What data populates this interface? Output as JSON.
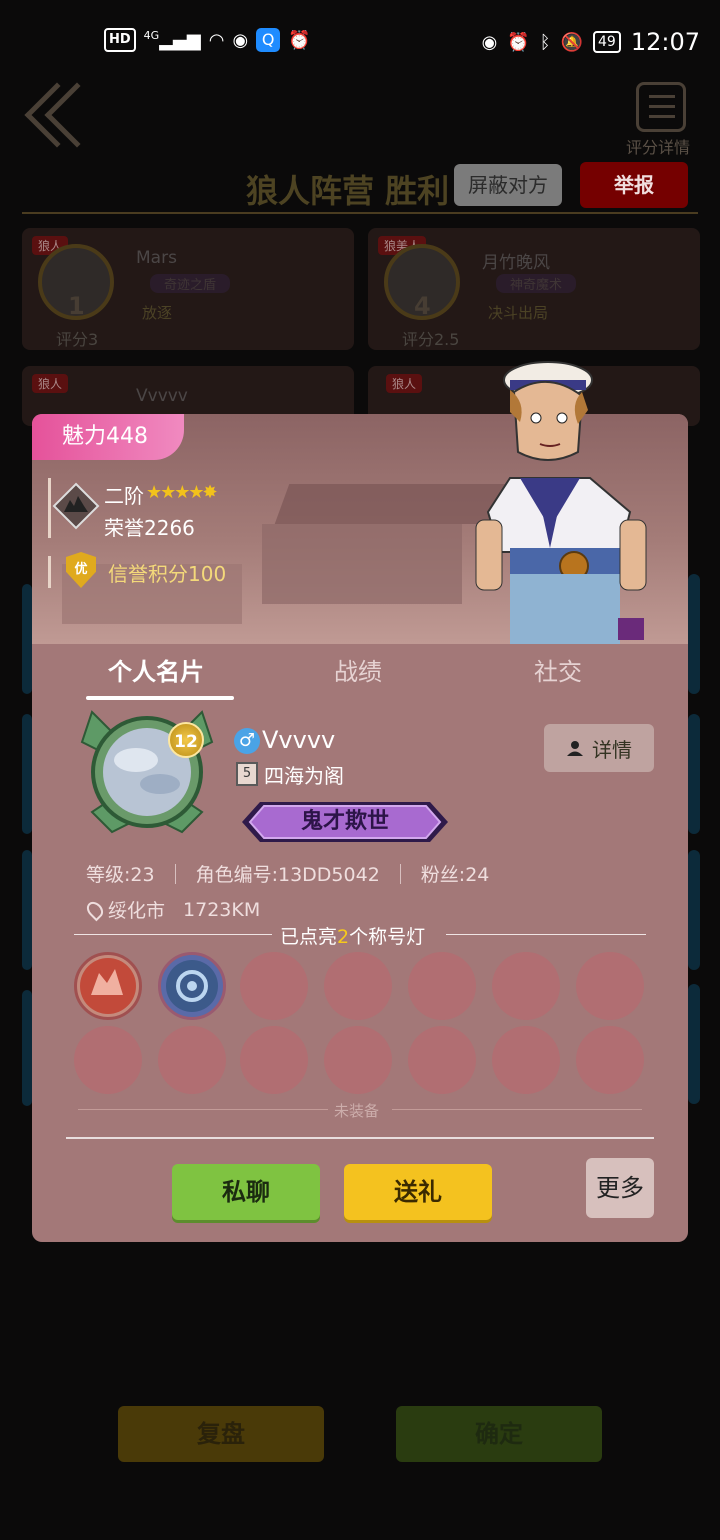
{
  "status_bar": {
    "hd": "HD",
    "network": "4G",
    "battery": "49",
    "time": "12:07"
  },
  "header": {
    "score_detail_label": "评分详情",
    "faction_result": "狼人阵营  胜利",
    "mute_button": "屏蔽对方",
    "report_button": "举报"
  },
  "players": [
    {
      "tag": "狼人",
      "seat": "1",
      "name": "Mars",
      "subtitle": "奇迹之盾",
      "badge": "放逐",
      "rating": "评分3"
    },
    {
      "tag": "狼美人",
      "seat": "4",
      "name": "月竹晚风",
      "subtitle": "神奇魔术",
      "badge": "决斗出局",
      "rating": "评分2.5"
    },
    {
      "tag": "狼人",
      "seat": "",
      "name": "Vvvvv",
      "subtitle": "",
      "badge": "",
      "rating": ""
    },
    {
      "tag": "狼人",
      "seat": "",
      "name": "",
      "subtitle": "",
      "badge": "",
      "rating": ""
    }
  ],
  "profile": {
    "charm": "魅力448",
    "rank_name": "二阶",
    "stars": "★★★★✸",
    "honor": "荣誉2266",
    "credit_badge": "优",
    "credit": "信誉积分100",
    "tabs": [
      "个人名片",
      "战绩",
      "社交"
    ],
    "level": "12",
    "gender_symbol": "♂",
    "username": "Vvvvv",
    "clan_rank": "5",
    "clan": "四海为阁",
    "title": "鬼才欺世",
    "detail_button": "详情",
    "stat_level": "等级:23",
    "stat_id": "角色编号:13DD5042",
    "stat_fans": "粉丝:24",
    "location": "绥化市",
    "distance": "1723KM",
    "lamps_prefix": "已点亮",
    "lamps_count": "2",
    "lamps_suffix": "个称号灯",
    "unequipped": "未装备",
    "chat_button": "私聊",
    "gift_button": "送礼",
    "more_button": "更多"
  },
  "footer": {
    "replay_button": "复盘",
    "confirm_button": "确定"
  },
  "colors": {
    "popup_bg": "#a37878",
    "charm_pink": "#e5529a",
    "chat_green": "#7fc341",
    "gift_yellow": "#f4c21f",
    "report_red": "#750000"
  }
}
